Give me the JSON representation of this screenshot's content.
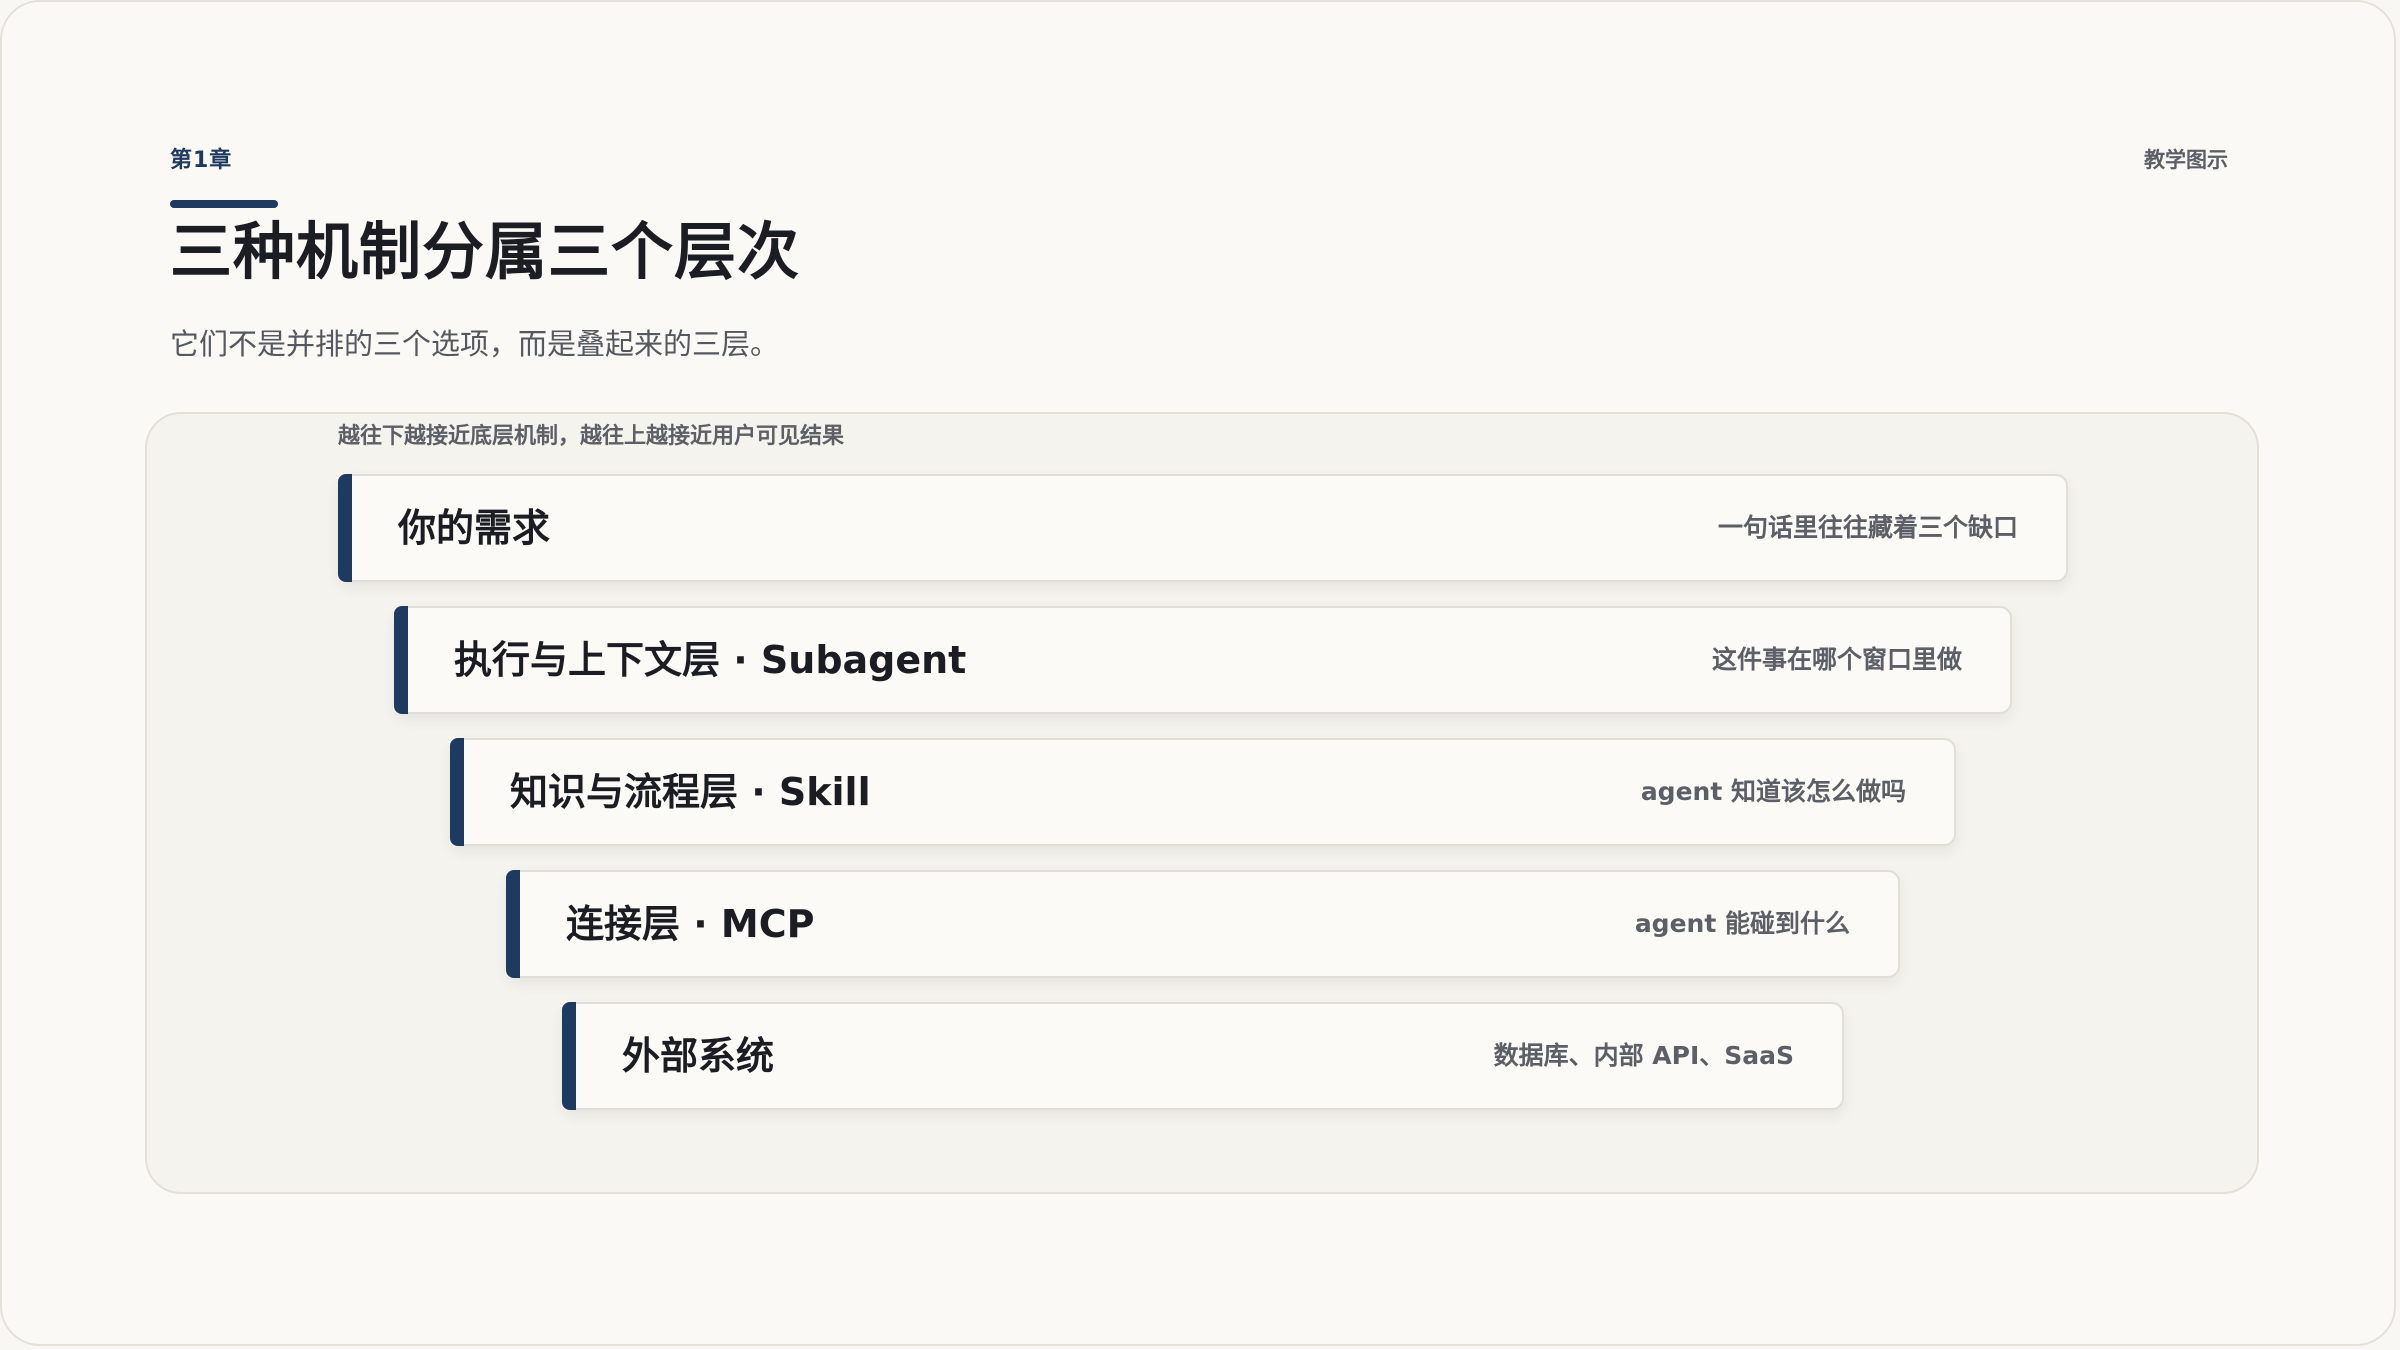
{
  "header": {
    "chapter": "第1章",
    "tag": "教学图示",
    "title": "三种机制分属三个层次",
    "subtitle": "它们不是并排的三个选项，而是叠起来的三层。"
  },
  "diagram": {
    "caption": "越往下越接近底层机制，越往上越接近用户可见结果",
    "layers": [
      {
        "name": "你的需求",
        "note": "一句话里往往藏着三个缺口"
      },
      {
        "name": "执行与上下文层 · Subagent",
        "note": "这件事在哪个窗口里做"
      },
      {
        "name": "知识与流程层 · Skill",
        "note": "agent 知道该怎么做吗"
      },
      {
        "name": "连接层 · MCP",
        "note": "agent 能碰到什么"
      },
      {
        "name": "外部系统",
        "note": "数据库、内部 API、SaaS"
      }
    ]
  },
  "colors": {
    "accent": "#1e3a5f",
    "background": "#faf9f5",
    "panel": "#f4f3ee"
  }
}
